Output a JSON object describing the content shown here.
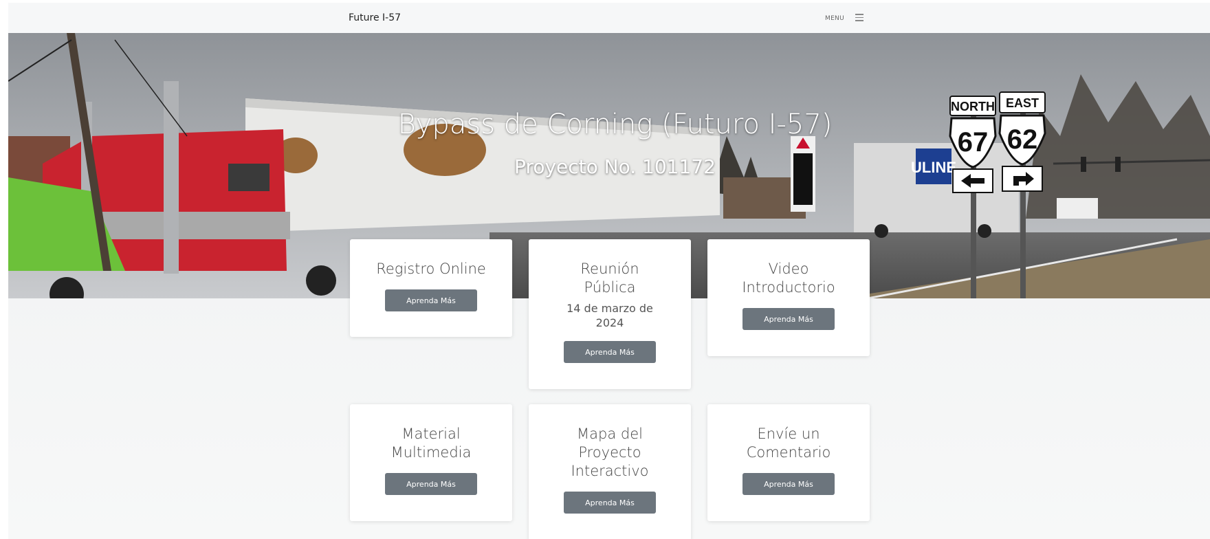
{
  "header": {
    "brand": "Future I-57",
    "menu_label": "MENU"
  },
  "hero": {
    "title": "Bypass de Corning (Futuro I-57)",
    "subtitle": "Proyecto No. 101172",
    "sign_north": "NORTH",
    "sign_east": "EAST",
    "route_67": "67",
    "route_62": "62",
    "trailer_brand": "ULINE"
  },
  "cards": [
    {
      "title_1": "Registro Online",
      "button": "Aprenda Más"
    },
    {
      "title_1": "Reunión",
      "title_2": "Pública",
      "date_1": "14 de marzo de",
      "date_2": "2024",
      "button": "Aprenda Más"
    },
    {
      "title_1": "Video",
      "title_2": "Introductorio",
      "button": "Aprenda Más"
    },
    {
      "title_1": "Material",
      "title_2": "Multimedia",
      "button": "Aprenda Más"
    },
    {
      "title_1": "Mapa del",
      "title_2": "Proyecto",
      "title_3": "Interactivo",
      "button": "Aprenda Más"
    },
    {
      "title_1": "Envíe un",
      "title_2": "Comentario",
      "button": "Aprenda Más"
    }
  ]
}
